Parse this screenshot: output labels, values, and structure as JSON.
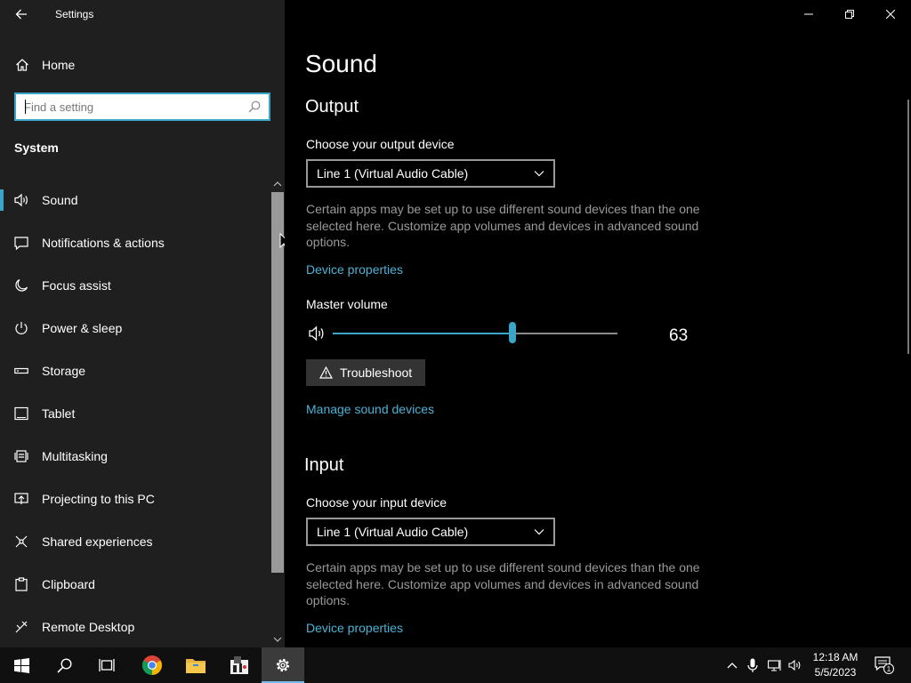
{
  "window": {
    "title": "Settings"
  },
  "sidebar": {
    "home_label": "Home",
    "search_placeholder": "Find a setting",
    "section": "System",
    "items": [
      {
        "label": "Sound",
        "icon": "speaker-icon",
        "active": true
      },
      {
        "label": "Notifications & actions",
        "icon": "notification-icon"
      },
      {
        "label": "Focus assist",
        "icon": "moon-icon"
      },
      {
        "label": "Power & sleep",
        "icon": "power-icon"
      },
      {
        "label": "Storage",
        "icon": "storage-icon"
      },
      {
        "label": "Tablet",
        "icon": "tablet-icon"
      },
      {
        "label": "Multitasking",
        "icon": "multitasking-icon"
      },
      {
        "label": "Projecting to this PC",
        "icon": "projecting-icon"
      },
      {
        "label": "Shared experiences",
        "icon": "shared-icon"
      },
      {
        "label": "Clipboard",
        "icon": "clipboard-icon"
      },
      {
        "label": "Remote Desktop",
        "icon": "remote-desktop-icon"
      }
    ]
  },
  "main": {
    "title": "Sound",
    "output": {
      "heading": "Output",
      "device_label": "Choose your output device",
      "device_value": "Line 1 (Virtual Audio Cable)",
      "description": "Certain apps may be set up to use different sound devices than the one selected here. Customize app volumes and devices in advanced sound options.",
      "device_properties_link": "Device properties",
      "master_volume_label": "Master volume",
      "volume": 63,
      "troubleshoot_label": "Troubleshoot",
      "manage_link": "Manage sound devices"
    },
    "input": {
      "heading": "Input",
      "device_label": "Choose your input device",
      "device_value": "Line 1 (Virtual Audio Cable)",
      "description": "Certain apps may be set up to use different sound devices than the one selected here. Customize app volumes and devices in advanced sound options.",
      "device_properties_link": "Device properties"
    }
  },
  "taskbar": {
    "time": "12:18 AM",
    "date": "5/5/2023",
    "notification_count": "1"
  },
  "colors": {
    "accent": "#3aa5c8",
    "link": "#4ab3d6",
    "sidebar_bg": "#1f1f1f"
  }
}
